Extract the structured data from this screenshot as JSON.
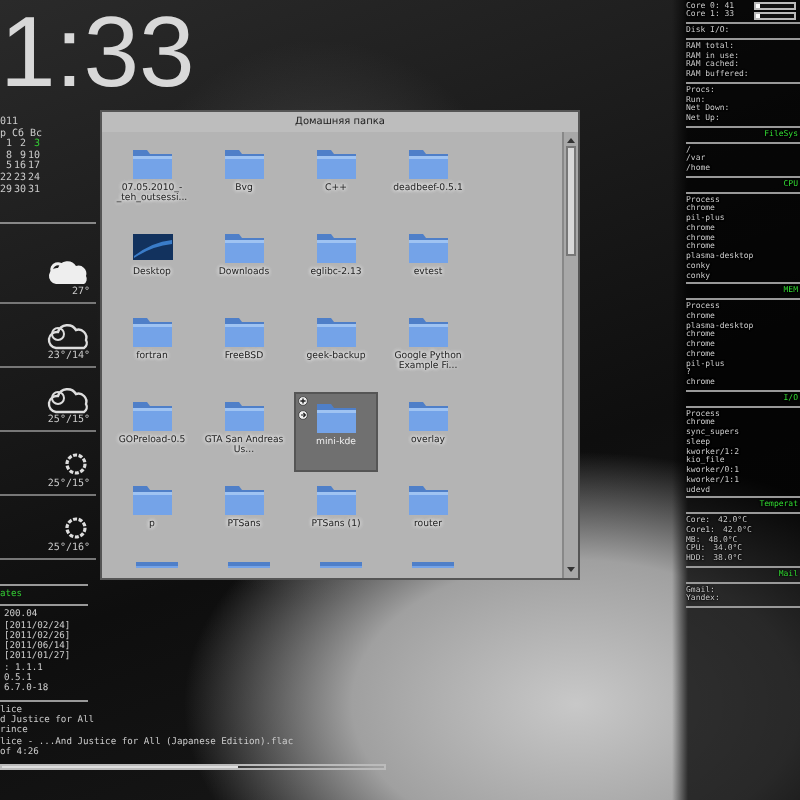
{
  "clock": "1:33",
  "calendar": {
    "title": "011",
    "weekdays": "р Сб Вс",
    "weeks": [
      [
        {
          "day": "1",
          "today": false
        },
        {
          "day": "2",
          "today": false
        },
        {
          "day": "3",
          "today": true
        }
      ],
      [
        {
          "day": "8",
          "today": false
        },
        {
          "day": "9",
          "today": false
        },
        {
          "day": "10",
          "today": false
        }
      ],
      [
        {
          "day": "5",
          "today": false
        },
        {
          "day": "16",
          "today": false
        },
        {
          "day": "17",
          "today": false
        }
      ],
      [
        {
          "day": "22",
          "today": false
        },
        {
          "day": "23",
          "today": false
        },
        {
          "day": "24",
          "today": false
        }
      ],
      [
        {
          "day": "29",
          "today": false
        },
        {
          "day": "30",
          "today": false
        },
        {
          "day": "31",
          "today": false
        }
      ]
    ]
  },
  "weather": [
    {
      "kind": "cloudy",
      "temp": "27°"
    },
    {
      "kind": "partly",
      "temp": "23°/14°"
    },
    {
      "kind": "partly",
      "temp": "25°/15°"
    },
    {
      "kind": "sunny",
      "temp": "25°/15°"
    },
    {
      "kind": "sunny",
      "temp": "25°/16°"
    }
  ],
  "updates": {
    "header": "ates",
    "lines": [
      "200.04",
      "[2011/02/24]",
      "[2011/02/26]",
      "[2011/06/14]",
      "[2011/01/27]",
      ": 1.1.1",
      "0.5.1",
      "6.7.0-18"
    ]
  },
  "player": {
    "lines": [
      "lice",
      "d Justice for All",
      "rince",
      "lice - ...And Justice for All (Japanese Edition).flac",
      "of 4:26"
    ],
    "level": 0.62
  },
  "window": {
    "title": "Домашняя папка",
    "items": [
      {
        "label": "07.05.2010_-_teh_outsessi...",
        "kind": "folder",
        "selected": false
      },
      {
        "label": "Bvg",
        "kind": "folder",
        "selected": false
      },
      {
        "label": "C++",
        "kind": "folder",
        "selected": false
      },
      {
        "label": "deadbeef-0.5.1",
        "kind": "folder",
        "selected": false
      },
      {
        "label": "Desktop",
        "kind": "desktop",
        "selected": false
      },
      {
        "label": "Downloads",
        "kind": "folder",
        "selected": false
      },
      {
        "label": "eglibc-2.13",
        "kind": "folder",
        "selected": false
      },
      {
        "label": "evtest",
        "kind": "folder",
        "selected": false
      },
      {
        "label": "fortran",
        "kind": "folder",
        "selected": false
      },
      {
        "label": "FreeBSD",
        "kind": "folder",
        "selected": false
      },
      {
        "label": "geek-backup",
        "kind": "folder",
        "selected": false
      },
      {
        "label": "Google Python Example Fi...",
        "kind": "folder",
        "selected": false
      },
      {
        "label": "GOPreload-0.5",
        "kind": "folder",
        "selected": false
      },
      {
        "label": "GTA San Andreas Us...",
        "kind": "folder",
        "selected": false
      },
      {
        "label": "mini-kde",
        "kind": "folder",
        "selected": true
      },
      {
        "label": "overlay",
        "kind": "folder",
        "selected": false
      },
      {
        "label": "p",
        "kind": "folder",
        "selected": false
      },
      {
        "label": "PTSans",
        "kind": "folder",
        "selected": false
      },
      {
        "label": "PTSans (1)",
        "kind": "folder",
        "selected": false
      },
      {
        "label": "router",
        "kind": "folder",
        "selected": false
      }
    ]
  },
  "monitor": {
    "cores": [
      {
        "label": "Core 0: 41",
        "level": 0.1
      },
      {
        "label": "Core 1: 33",
        "level": 0.08
      }
    ],
    "sections": [
      {
        "lines": [
          {
            "label": "Disk I/O:"
          }
        ]
      },
      {
        "lines": [
          {
            "label": "RAM total:"
          },
          {
            "label": "RAM in use:"
          },
          {
            "label": "RAM cached:"
          },
          {
            "label": "RAM buffered:"
          }
        ]
      },
      {
        "lines": [
          {
            "label": "Procs:"
          },
          {
            "label": "Run:"
          },
          {
            "label": "Net Down:"
          },
          {
            "label": "Net Up:"
          }
        ]
      },
      {
        "header": "FileSys",
        "lines": [
          {
            "label": "/"
          },
          {
            "label": "/var"
          },
          {
            "label": "/home"
          }
        ]
      },
      {
        "header": "CPU",
        "lines": [
          {
            "label": "Process"
          },
          {
            "label": "chrome"
          },
          {
            "label": "pil-plus"
          },
          {
            "label": "chrome"
          },
          {
            "label": "chrome"
          },
          {
            "label": "chrome"
          },
          {
            "label": "plasma-desktop"
          },
          {
            "label": "conky"
          },
          {
            "label": "conky"
          }
        ]
      },
      {
        "header": "MEM",
        "lines": [
          {
            "label": "Process"
          },
          {
            "label": "chrome"
          },
          {
            "label": "plasma-desktop"
          },
          {
            "label": "chrome"
          },
          {
            "label": "chrome"
          },
          {
            "label": "chrome"
          },
          {
            "label": "pil-plus"
          },
          {
            "label": "?"
          },
          {
            "label": "chrome"
          }
        ]
      },
      {
        "header": "I/O",
        "lines": [
          {
            "label": "Process"
          },
          {
            "label": "chrome"
          },
          {
            "label": "sync_supers"
          },
          {
            "label": "sleep"
          },
          {
            "label": "kworker/1:2"
          },
          {
            "label": "kio_file"
          },
          {
            "label": "kworker/0:1"
          },
          {
            "label": "kworker/1:1"
          },
          {
            "label": "udevd"
          }
        ]
      },
      {
        "header": "Temperat",
        "lines": [
          {
            "label": "Core:",
            "value": "42.0°C"
          },
          {
            "label": "Core1:",
            "value": "42.0°C"
          },
          {
            "label": "MB:",
            "value": "48.0°C"
          },
          {
            "label": "CPU:",
            "value": "34.0°C"
          },
          {
            "label": "HDD:",
            "value": "38.0°C"
          }
        ]
      },
      {
        "header": "Mail",
        "lines": [
          {
            "label": "Gmail:"
          },
          {
            "label": "Yandex:"
          }
        ]
      }
    ]
  }
}
